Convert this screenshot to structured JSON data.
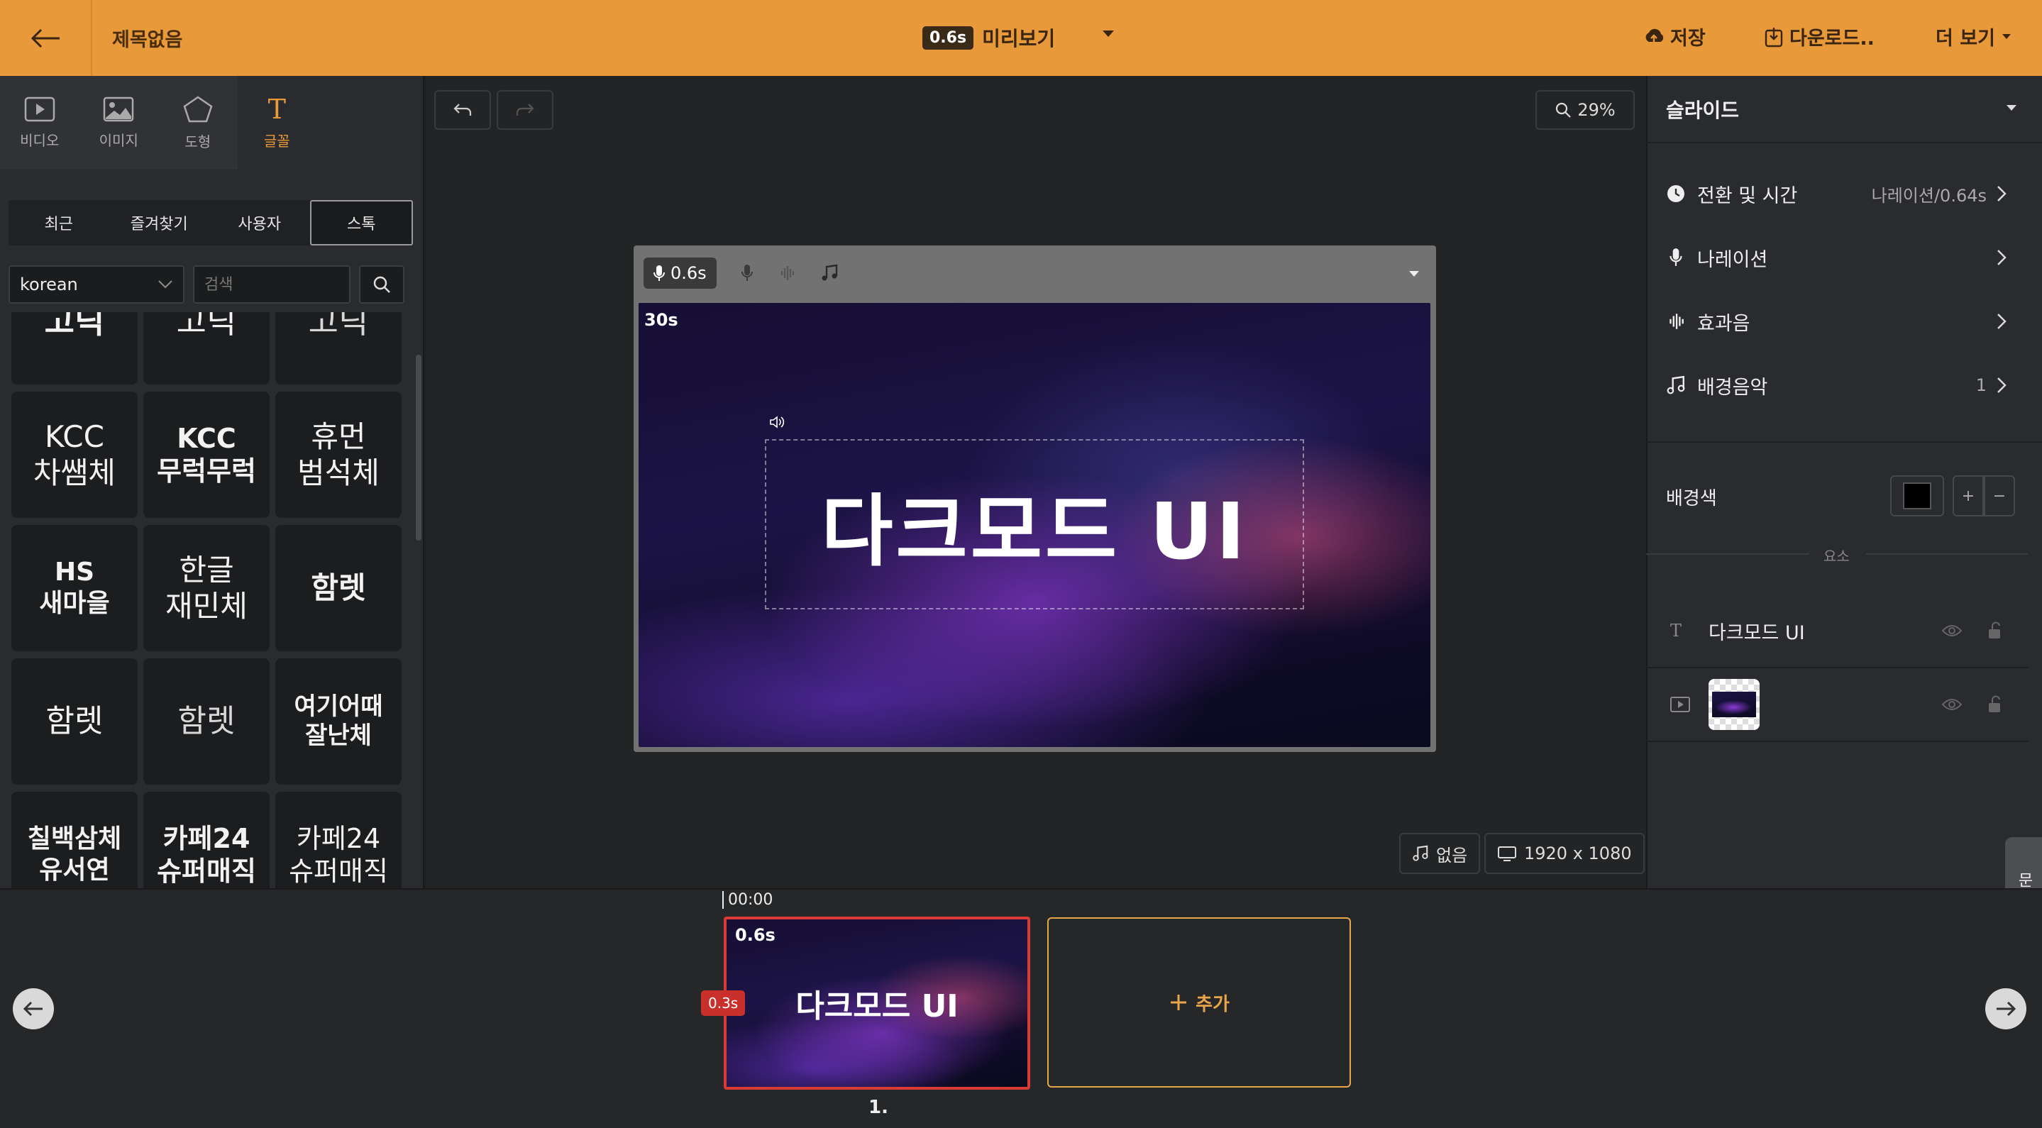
{
  "header": {
    "title": "제목없음",
    "preview_duration": "0.6s",
    "preview_label": "미리보기",
    "save_label": "저장",
    "download_label": "다운로드..",
    "more_label": "더 보기"
  },
  "left_panel": {
    "tool_tabs": [
      {
        "label": "비디오",
        "icon": "video-icon"
      },
      {
        "label": "이미지",
        "icon": "image-icon"
      },
      {
        "label": "도형",
        "icon": "pentagon-icon"
      },
      {
        "label": "글꼴",
        "icon": "text-icon",
        "active": true
      }
    ],
    "sub_tabs": [
      "최근",
      "즐겨찾기",
      "사용자",
      "스톡"
    ],
    "active_sub_tab": "스톡",
    "language": "korean",
    "search_placeholder": "검색",
    "fonts": [
      "고딕",
      "고딕",
      "고딕",
      "KCC\n차쌤체",
      "KCC\n무럭무럭",
      "휴먼\n범석체",
      "HS\n새마을",
      "한글\n재민체",
      "함렛",
      "함렛",
      "함렛",
      "여기어때\n잘난체",
      "칠백삼체\n유서연",
      "카페24\n슈퍼매직",
      "카페24\n슈퍼매직"
    ]
  },
  "canvas": {
    "zoom": "29%",
    "voice_duration": "0.6s",
    "slide_duration": "30s",
    "text": "다크모드 UI",
    "music_label": "없음",
    "resolution": "1920 x 1080"
  },
  "right_panel": {
    "section_title": "슬라이드",
    "rows": [
      {
        "label": "전환 및 시간",
        "value": "나레이션/0.64s",
        "icon": "clock-icon"
      },
      {
        "label": "나레이션",
        "value": "",
        "icon": "mic-icon"
      },
      {
        "label": "효과음",
        "value": "",
        "icon": "waveform-icon"
      },
      {
        "label": "배경음악",
        "value": "1",
        "icon": "music-note-icon"
      }
    ],
    "bg_color_label": "배경색",
    "bg_color": "#000000",
    "plus_label": "+",
    "minus_label": "−",
    "elements_label": "요소",
    "layers": [
      {
        "type": "text",
        "label": "다크모드 UI"
      },
      {
        "type": "video",
        "label": ""
      }
    ],
    "inquiry_label": "문의"
  },
  "timeline": {
    "time_marker": "00:00",
    "slides": [
      {
        "number": "1.",
        "duration": "0.6s",
        "text": "다크모드 UI",
        "transition": "0.3s"
      }
    ],
    "add_label": "추가"
  },
  "colors": {
    "accent": "#e8993a",
    "timeline_border": "#d93a34"
  }
}
